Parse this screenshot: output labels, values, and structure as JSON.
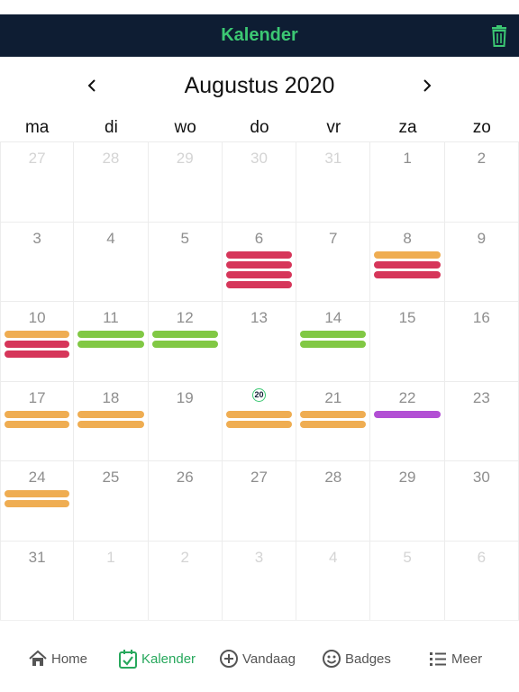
{
  "header": {
    "title": "Kalender",
    "trash_icon": "trash-icon"
  },
  "month_title": "Augustus 2020",
  "nav": {
    "prev": "‹",
    "next": "›"
  },
  "weekdays": [
    "ma",
    "di",
    "wo",
    "do",
    "vr",
    "za",
    "zo"
  ],
  "colors": {
    "orange": "#efad52",
    "red": "#d6365a",
    "green": "#81c844",
    "purple": "#b24fd4",
    "brand": "#3cc873",
    "navy": "#0e1d33"
  },
  "weeks": [
    [
      {
        "d": "27",
        "dim": true,
        "bars": []
      },
      {
        "d": "28",
        "dim": true,
        "bars": []
      },
      {
        "d": "29",
        "dim": true,
        "bars": []
      },
      {
        "d": "30",
        "dim": true,
        "bars": []
      },
      {
        "d": "31",
        "dim": true,
        "bars": []
      },
      {
        "d": "1",
        "dim": false,
        "bars": []
      },
      {
        "d": "2",
        "dim": false,
        "bars": []
      }
    ],
    [
      {
        "d": "3",
        "dim": false,
        "bars": []
      },
      {
        "d": "4",
        "dim": false,
        "bars": []
      },
      {
        "d": "5",
        "dim": false,
        "bars": []
      },
      {
        "d": "6",
        "dim": false,
        "bars": [
          "red",
          "red",
          "red",
          "red"
        ]
      },
      {
        "d": "7",
        "dim": false,
        "bars": []
      },
      {
        "d": "8",
        "dim": false,
        "bars": [
          "orange",
          "red",
          "red"
        ]
      },
      {
        "d": "9",
        "dim": false,
        "bars": []
      }
    ],
    [
      {
        "d": "10",
        "dim": false,
        "bars": [
          "orange",
          "red",
          "red"
        ]
      },
      {
        "d": "11",
        "dim": false,
        "bars": [
          "green",
          "green"
        ]
      },
      {
        "d": "12",
        "dim": false,
        "bars": [
          "green",
          "green"
        ]
      },
      {
        "d": "13",
        "dim": false,
        "bars": []
      },
      {
        "d": "14",
        "dim": false,
        "bars": [
          "green",
          "green"
        ]
      },
      {
        "d": "15",
        "dim": false,
        "bars": []
      },
      {
        "d": "16",
        "dim": false,
        "bars": []
      }
    ],
    [
      {
        "d": "17",
        "dim": false,
        "bars": [
          "orange",
          "orange"
        ]
      },
      {
        "d": "18",
        "dim": false,
        "bars": [
          "orange",
          "orange"
        ]
      },
      {
        "d": "19",
        "dim": false,
        "bars": []
      },
      {
        "d": "20",
        "dim": false,
        "today": true,
        "bars": [
          "orange",
          "orange"
        ]
      },
      {
        "d": "21",
        "dim": false,
        "bars": [
          "orange",
          "orange"
        ]
      },
      {
        "d": "22",
        "dim": false,
        "bars": [
          "purple"
        ]
      },
      {
        "d": "23",
        "dim": false,
        "bars": []
      }
    ],
    [
      {
        "d": "24",
        "dim": false,
        "bars": [
          "orange",
          "orange"
        ]
      },
      {
        "d": "25",
        "dim": false,
        "bars": []
      },
      {
        "d": "26",
        "dim": false,
        "bars": []
      },
      {
        "d": "27",
        "dim": false,
        "bars": []
      },
      {
        "d": "28",
        "dim": false,
        "bars": []
      },
      {
        "d": "29",
        "dim": false,
        "bars": []
      },
      {
        "d": "30",
        "dim": false,
        "bars": []
      }
    ],
    [
      {
        "d": "31",
        "dim": false,
        "bars": []
      },
      {
        "d": "1",
        "dim": true,
        "bars": []
      },
      {
        "d": "2",
        "dim": true,
        "bars": []
      },
      {
        "d": "3",
        "dim": true,
        "bars": []
      },
      {
        "d": "4",
        "dim": true,
        "bars": []
      },
      {
        "d": "5",
        "dim": true,
        "bars": []
      },
      {
        "d": "6",
        "dim": true,
        "bars": []
      }
    ]
  ],
  "tabs": [
    {
      "label": "Home",
      "icon": "home-icon",
      "active": false
    },
    {
      "label": "Kalender",
      "icon": "calendar-check-icon",
      "active": true
    },
    {
      "label": "Vandaag",
      "icon": "plus-circle-icon",
      "active": false
    },
    {
      "label": "Badges",
      "icon": "smiley-icon",
      "active": false
    },
    {
      "label": "Meer",
      "icon": "list-icon",
      "active": false
    }
  ]
}
